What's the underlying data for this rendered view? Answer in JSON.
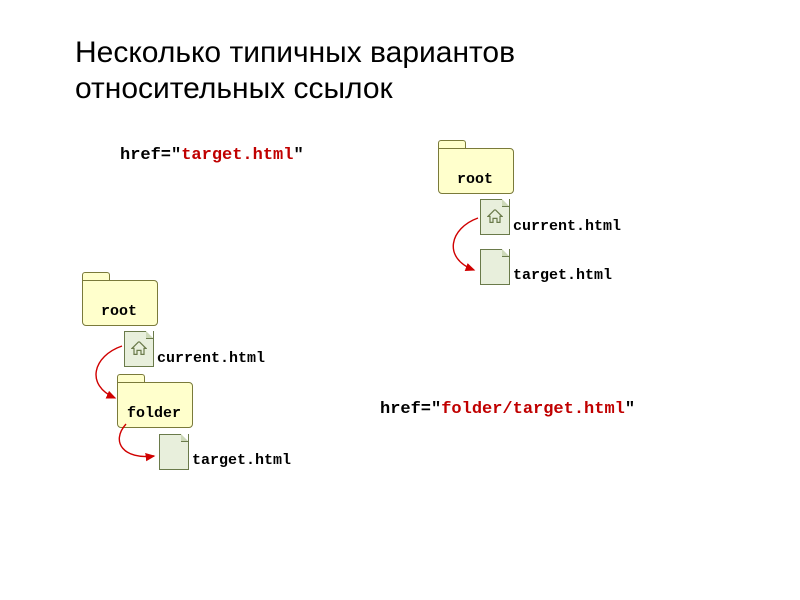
{
  "title": "Несколько типичных вариантов относительных ссылок",
  "href1": {
    "prefix": "href=\"",
    "path": "target.html",
    "suffix": "\""
  },
  "href2": {
    "prefix": "href=\"",
    "path": "folder/target.html",
    "suffix": "\""
  },
  "example1": {
    "root_label": "root",
    "current_label": "current.html",
    "target_label": "target.html"
  },
  "example2": {
    "root_label": "root",
    "current_label": "current.html",
    "folder_label": "folder",
    "target_label": "target.html"
  }
}
